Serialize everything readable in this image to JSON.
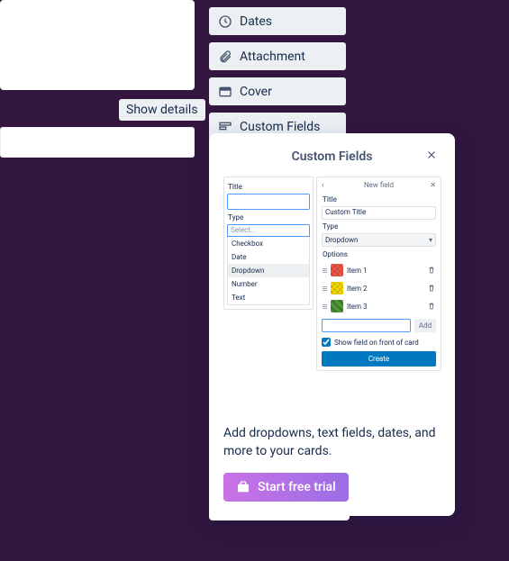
{
  "card": {
    "show_details": "Show details"
  },
  "sidebar": {
    "dates": "Dates",
    "attachment": "Attachment",
    "cover": "Cover",
    "custom_fields": "Custom Fields"
  },
  "popover": {
    "title": "Custom Fields",
    "desc": "Add dropdowns, text fields, dates, and more to your cards.",
    "trial_label": "Start free trial"
  },
  "preview": {
    "left": {
      "title_label": "Title",
      "type_label": "Type",
      "select_placeholder": "Select...",
      "options": [
        "Checkbox",
        "Date",
        "Dropdown",
        "Number",
        "Text"
      ],
      "selected": "Dropdown"
    },
    "right": {
      "header": "New field",
      "title_label": "Title",
      "title_value": "Custom Title",
      "type_label": "Type",
      "type_value": "Dropdown",
      "options_label": "Options",
      "options": [
        {
          "label": "Item 1",
          "swatch": "sw-red"
        },
        {
          "label": "Item 2",
          "swatch": "sw-yellow"
        },
        {
          "label": "Item 3",
          "swatch": "sw-green"
        }
      ],
      "add_label": "Add",
      "show_on_front": "Show field on front of card",
      "create_label": "Create"
    }
  }
}
